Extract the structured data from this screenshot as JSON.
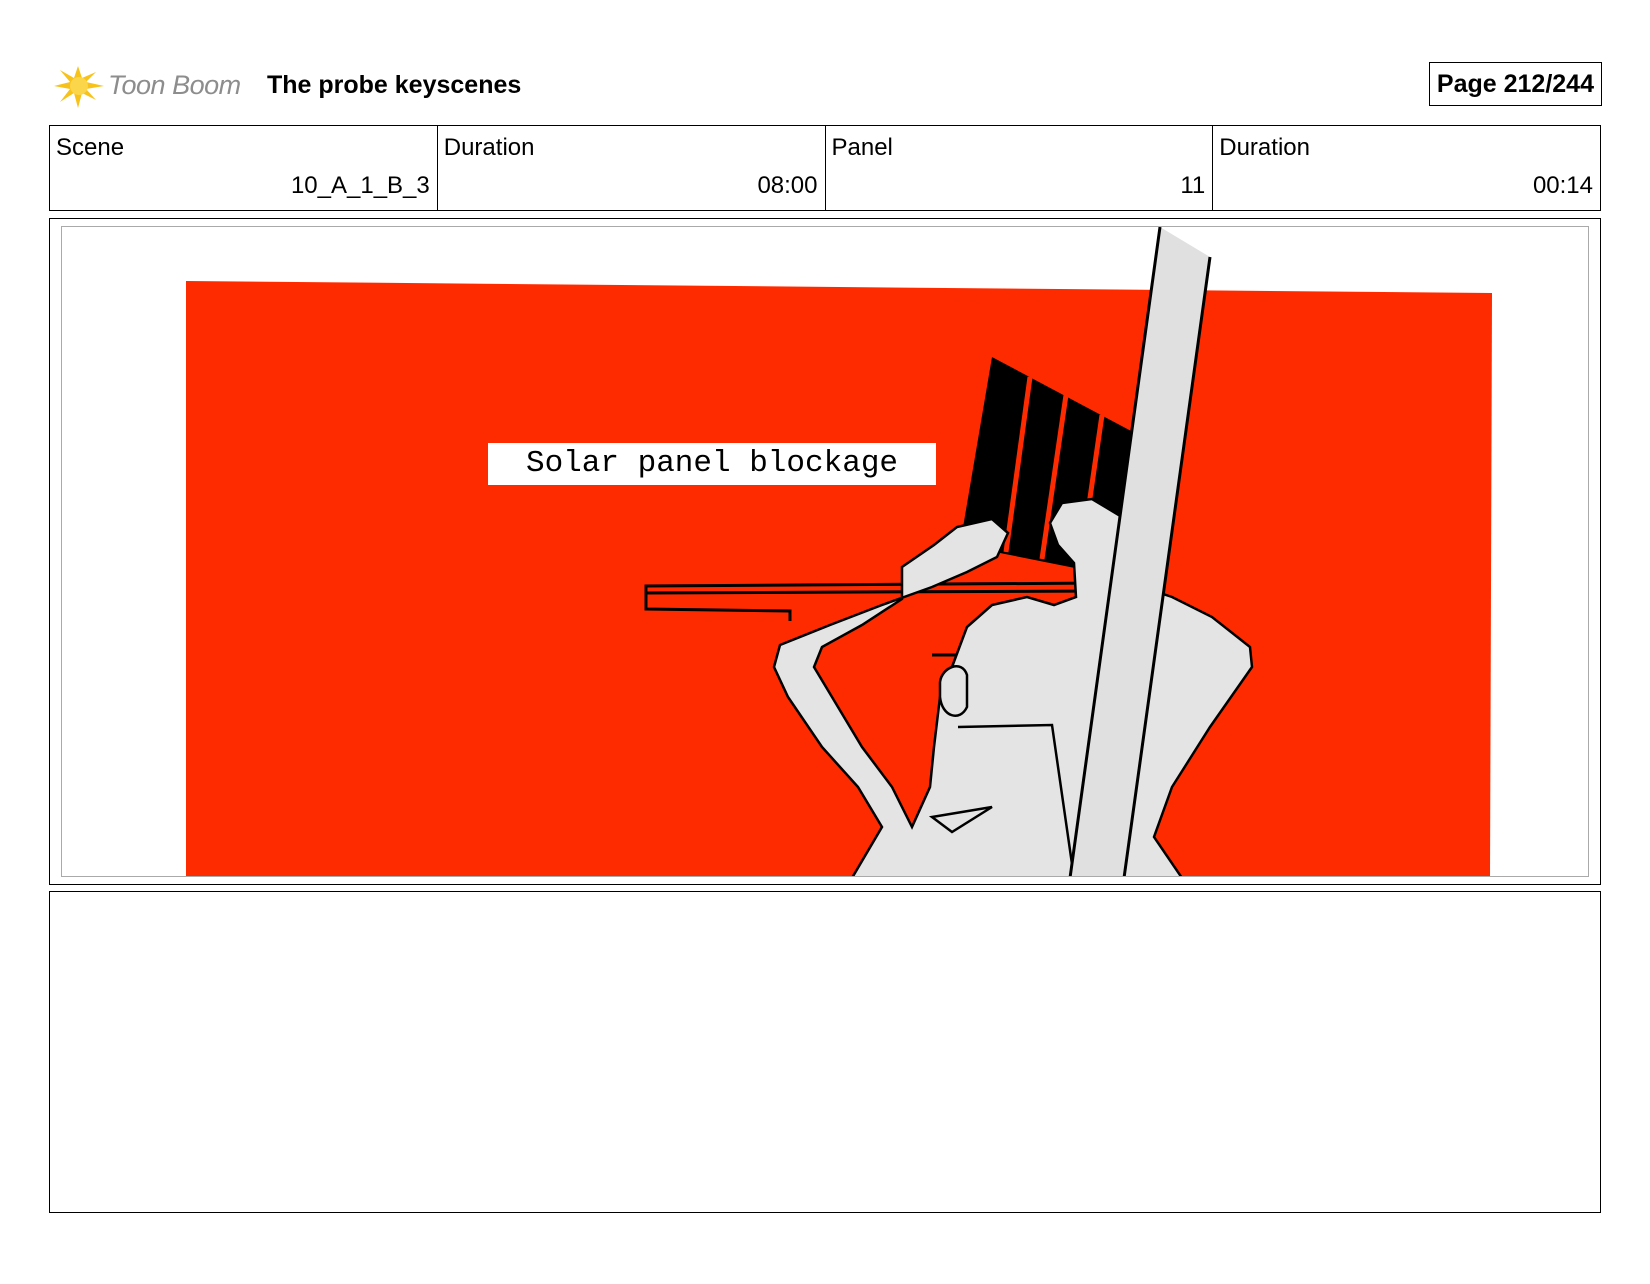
{
  "header": {
    "logo_text": "Toon Boom",
    "project_title": "The probe keyscenes",
    "page_label": "Page 212/244"
  },
  "info": [
    {
      "label": "Scene",
      "value": "10_A_1_B_3"
    },
    {
      "label": "Duration",
      "value": "08:00"
    },
    {
      "label": "Panel",
      "value": "11"
    },
    {
      "label": "Duration",
      "value": "00:14"
    }
  ],
  "panel": {
    "caption": "Solar panel blockage",
    "background_color": "#ff2b00",
    "figure_color": "#e4e4e4"
  },
  "notes": {
    "text": ""
  }
}
